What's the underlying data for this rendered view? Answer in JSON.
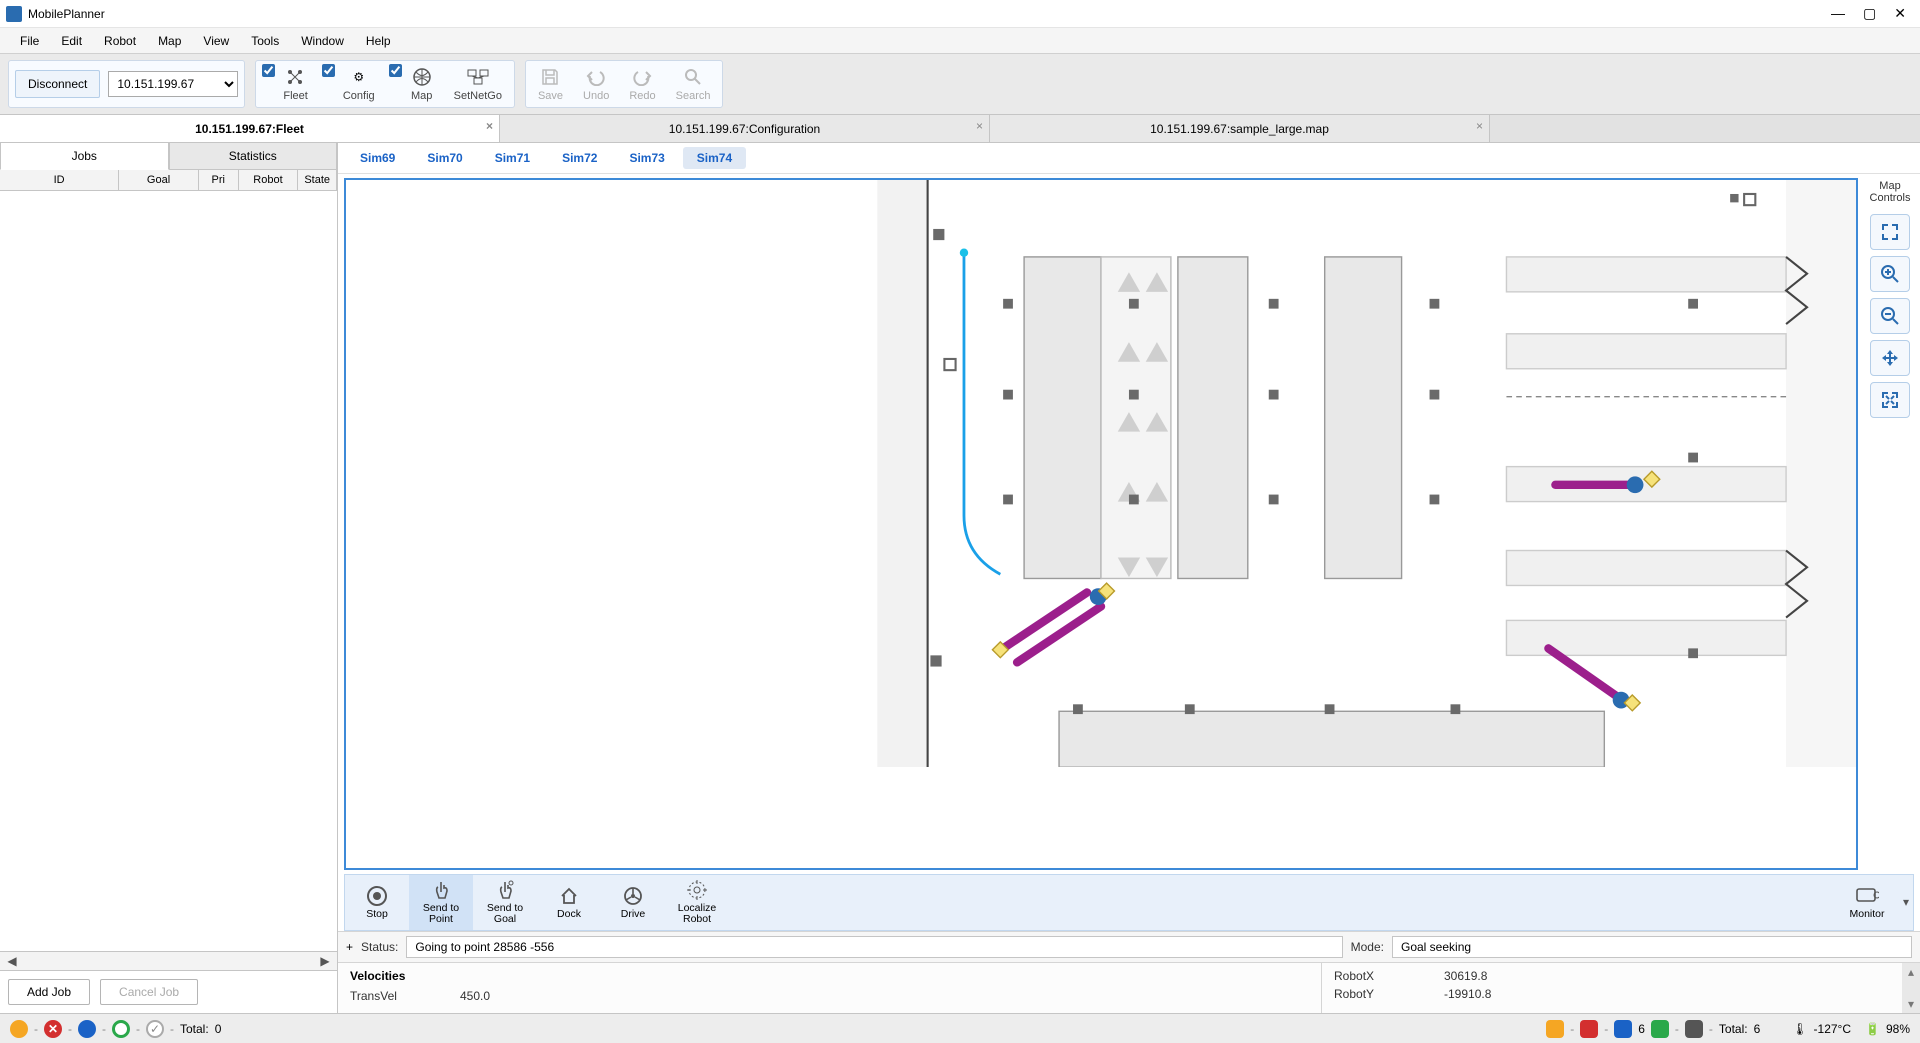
{
  "app": {
    "title": "MobilePlanner"
  },
  "menu": [
    "File",
    "Edit",
    "Robot",
    "Map",
    "View",
    "Tools",
    "Window",
    "Help"
  ],
  "toolbar": {
    "disconnect": "Disconnect",
    "ip": "10.151.199.67",
    "fleet": "Fleet",
    "config": "Config",
    "map": "Map",
    "setnetgo": "SetNetGo",
    "save": "Save",
    "undo": "Undo",
    "redo": "Redo",
    "search": "Search"
  },
  "doc_tabs": [
    {
      "label": "10.151.199.67:Fleet",
      "active": true
    },
    {
      "label": "10.151.199.67:Configuration",
      "active": false
    },
    {
      "label": "10.151.199.67:sample_large.map",
      "active": false
    }
  ],
  "left_tabs": {
    "jobs": "Jobs",
    "stats": "Statistics"
  },
  "jobs_cols": {
    "id": "ID",
    "goal": "Goal",
    "pri": "Pri",
    "robot": "Robot",
    "state": "State"
  },
  "jobs_footer": {
    "add": "Add Job",
    "cancel": "Cancel Job"
  },
  "sim_tabs": [
    "Sim69",
    "Sim70",
    "Sim71",
    "Sim72",
    "Sim73",
    "Sim74"
  ],
  "sim_active": "Sim74",
  "map_controls_label": "Map Controls",
  "actions": {
    "stop": "Stop",
    "sendpoint": "Send to Point",
    "sendgoal": "Send to Goal",
    "dock": "Dock",
    "drive": "Drive",
    "localize": "Localize Robot",
    "monitor": "Monitor"
  },
  "status": {
    "status_label": "Status:",
    "status_value": "Going to point 28586 -556",
    "mode_label": "Mode:",
    "mode_value": "Goal seeking",
    "plus": "+"
  },
  "velocities": {
    "title": "Velocities",
    "transvel_label": "TransVel",
    "transvel_value": "450.0"
  },
  "robot_pos": {
    "x_label": "RobotX",
    "x_value": "30619.8",
    "y_label": "RobotY",
    "y_value": "-19910.8"
  },
  "footer": {
    "total_left_label": "Total:",
    "total_left_value": "0",
    "blue_count": "6",
    "total_right_label": "Total:",
    "total_right_value": "6",
    "temp": "-127°C",
    "batt": "98%"
  }
}
